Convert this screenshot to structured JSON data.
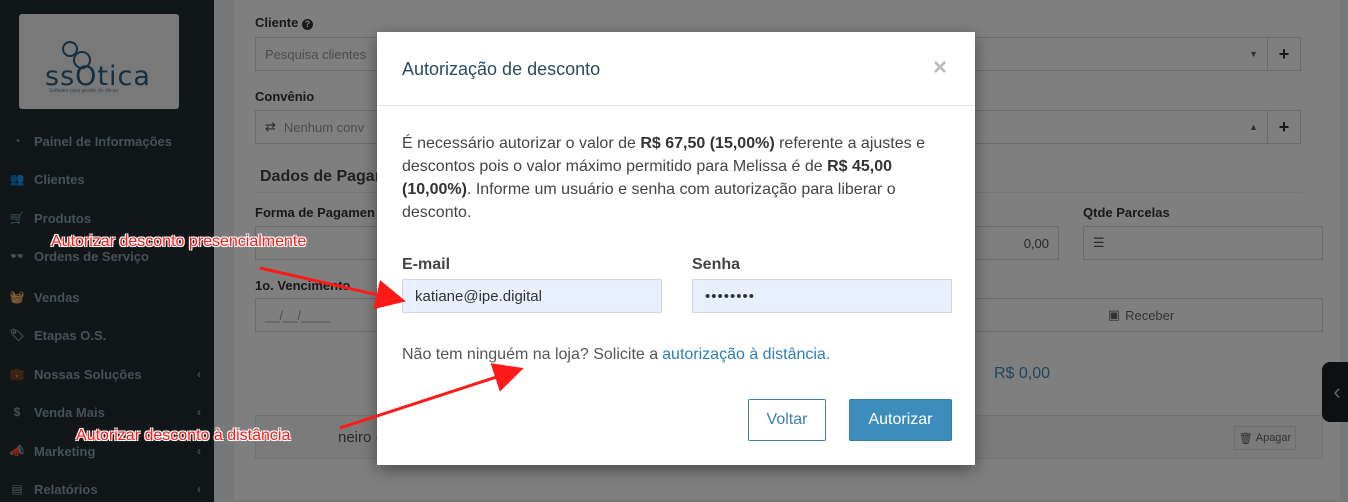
{
  "sidebar": {
    "logo": {
      "brand": "ssOtica",
      "tagline": "Software para gestão de óticas"
    },
    "items": [
      {
        "label": "Painel de Informações",
        "icon": "dashboard-icon",
        "glyph": "◔",
        "chevron": ""
      },
      {
        "label": "Clientes",
        "icon": "users-icon",
        "glyph": "👥",
        "chevron": ""
      },
      {
        "label": "Produtos",
        "icon": "cart-icon",
        "glyph": "🛒",
        "chevron": ""
      },
      {
        "label": "Ordens de Serviço",
        "icon": "glasses-icon",
        "glyph": "👓",
        "chevron": ""
      },
      {
        "label": "Vendas",
        "icon": "basket-icon",
        "glyph": "🧺",
        "chevron": ""
      },
      {
        "label": "Etapas O.S.",
        "icon": "tag-icon",
        "glyph": "🏷",
        "chevron": ""
      },
      {
        "label": "Nossas Soluções",
        "icon": "briefcase-icon",
        "glyph": "💼",
        "chevron": "‹"
      },
      {
        "label": "Venda Mais",
        "icon": "dollar-icon",
        "glyph": "$",
        "chevron": "‹"
      },
      {
        "label": "Marketing",
        "icon": "megaphone-icon",
        "glyph": "📣",
        "chevron": "‹"
      },
      {
        "label": "Relatórios",
        "icon": "chart-icon",
        "glyph": "▤",
        "chevron": "‹"
      }
    ]
  },
  "form": {
    "cliente_label": "Cliente",
    "cliente_placeholder": "Pesquisa clientes",
    "convenio_label": "Convênio",
    "convenio_value": "Nenhum conv",
    "pagamento_title": "Dados de Pagan",
    "forma_label": "Forma de Pagamen",
    "valor_value": "0,00",
    "parcelas_label": "Qtde Parcelas",
    "vencimento_label": "1o. Vencimento",
    "vencimento_placeholder": "__/__/____",
    "receber_label": "Receber",
    "total_value": "R$ 0,00",
    "dinheiro_label": "neiro -",
    "apagar_label": "Apagar"
  },
  "modal": {
    "title": "Autorização de desconto",
    "close": "×",
    "text_1": "É necessário autorizar o valor de ",
    "amount_bold": "R$ 67,50 (15,00%)",
    "text_2": " referente a ajustes e descontos pois o valor máximo permitido para Melissa é de ",
    "max_bold": "R$ 45,00 (10,00%)",
    "text_3": ". Informe um usuário e senha com autorização para liberar o desconto.",
    "email_label": "E-mail",
    "email_value": "katiane@ipe.digital",
    "password_label": "Senha",
    "password_value": "••••••••",
    "remote_text": "Não tem ninguém na loja? Solicite a",
    "remote_link": "autorização à distância.",
    "back_button": "Voltar",
    "authorize_button": "Autorizar"
  },
  "annotations": {
    "presencial": "Autorizar desconto presencialmente",
    "distancia": "Autorizar desconto à distância",
    "color": "#ff1a1a"
  },
  "colors": {
    "sidebar_bg": "#222d32",
    "primary": "#3c8dbc",
    "title": "#2c4a60"
  }
}
